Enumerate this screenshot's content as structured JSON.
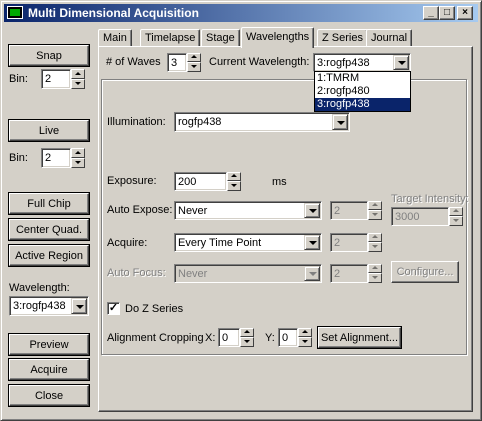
{
  "window": {
    "title": "Multi Dimensional Acquisition",
    "controls": [
      "_",
      "□",
      "×"
    ]
  },
  "left": {
    "snap": "Snap",
    "bin1_label": "Bin:",
    "bin1_value": "2",
    "live": "Live",
    "bin2_label": "Bin:",
    "bin2_value": "2",
    "full_chip": "Full Chip",
    "center_quad": "Center Quad.",
    "active_region": "Active Region",
    "wavelength_label": "Wavelength:",
    "wavelength_value": "3:rogfp438",
    "preview": "Preview",
    "acquire": "Acquire",
    "close": "Close"
  },
  "tabs": [
    "Main",
    "Timelapse",
    "Stage",
    "Wavelengths",
    "Z Series",
    "Journal"
  ],
  "active_tab": "Wavelengths",
  "wavelengths": {
    "num_waves_label": "# of Waves",
    "num_waves_value": "3",
    "current_wavelength_label": "Current Wavelength:",
    "current_wavelength_value": "3:rogfp438",
    "dropdown_options": [
      "1:TMRM",
      "2:rogfp480",
      "3:rogfp438"
    ],
    "dropdown_selected_index": 2,
    "illumination_label": "Illumination:",
    "illumination_value": "rogfp438",
    "exposure_label": "Exposure:",
    "exposure_value": "200",
    "exposure_unit": "ms",
    "auto_expose_label": "Auto Expose:",
    "auto_expose_value": "Never",
    "auto_expose_num": "2",
    "target_intensity_label": "Target Intensity:",
    "target_intensity_value": "3000",
    "acquire_label": "Acquire:",
    "acquire_value": "Every Time Point",
    "acquire_num": "2",
    "auto_focus_label": "Auto Focus:",
    "auto_focus_value": "Never",
    "auto_focus_num": "2",
    "configure_label": "Configure...",
    "do_z_series_label": "Do Z Series",
    "do_z_series_checked": "✓",
    "alignment_label": "Alignment Cropping",
    "x_label": "X:",
    "x_value": "0",
    "y_label": "Y:",
    "y_value": "0",
    "set_alignment_label": "Set Alignment..."
  }
}
